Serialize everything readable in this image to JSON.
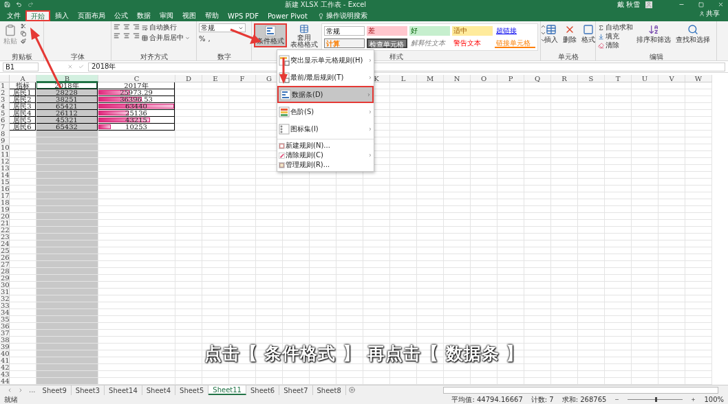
{
  "window": {
    "title": "新建 XLSX 工作表 - Excel",
    "user": "戴 秋雪",
    "share": "共享"
  },
  "ribbon_tabs": [
    {
      "label": "文件",
      "selected": false,
      "highlighted": false
    },
    {
      "label": "开始",
      "selected": true,
      "highlighted": true
    },
    {
      "label": "插入",
      "selected": false,
      "highlighted": false
    },
    {
      "label": "页面布局",
      "selected": false,
      "highlighted": false
    },
    {
      "label": "公式",
      "selected": false,
      "highlighted": false
    },
    {
      "label": "数据",
      "selected": false,
      "highlighted": false
    },
    {
      "label": "审阅",
      "selected": false,
      "highlighted": false
    },
    {
      "label": "视图",
      "selected": false,
      "highlighted": false
    },
    {
      "label": "帮助",
      "selected": false,
      "highlighted": false
    },
    {
      "label": "WPS PDF",
      "selected": false,
      "highlighted": false
    },
    {
      "label": "Power Pivot",
      "selected": false,
      "highlighted": false
    }
  ],
  "tell_me": "操作说明搜索",
  "clipboard": {
    "label": "剪贴板",
    "paste": "粘贴"
  },
  "font": {
    "label": "字体"
  },
  "alignment": {
    "label": "对齐方式",
    "wrap": "自动换行",
    "merge": "合并后居中"
  },
  "number": {
    "label": "数字",
    "format": "常规",
    "percent": "%",
    "comma": ","
  },
  "styles": {
    "label": "样式",
    "conditional": "条件格式",
    "conditional_highlighted": true,
    "table_format": [
      "套用",
      "表格格式"
    ],
    "gallery": [
      {
        "text": "常规",
        "kind": "normal"
      },
      {
        "text": "差",
        "kind": "bad"
      },
      {
        "text": "好",
        "kind": "good"
      },
      {
        "text": "适中",
        "kind": "neutral"
      },
      {
        "text": "超链接",
        "kind": "hyperlink"
      },
      {
        "text": "计算",
        "kind": "calc"
      },
      {
        "text": "检查单元格",
        "kind": "check"
      },
      {
        "text": "解释性文本",
        "kind": "explanatory"
      },
      {
        "text": "警告文本",
        "kind": "warning"
      },
      {
        "text": "链接单元格",
        "kind": "linked"
      }
    ]
  },
  "cells_group": {
    "label": "单元格",
    "buttons": [
      {
        "text": "插入",
        "kind": "insert"
      },
      {
        "text": "删除",
        "kind": "delete"
      },
      {
        "text": "格式",
        "kind": "format"
      }
    ]
  },
  "editing": {
    "label": "编辑",
    "items": [
      {
        "text": "自动求和",
        "kind": "sum"
      },
      {
        "text": "填充",
        "kind": "fill"
      },
      {
        "text": "清除",
        "kind": "clear"
      }
    ],
    "buttons": [
      {
        "text": "排序和筛选",
        "kind": "sort"
      },
      {
        "text": "查找和选择",
        "kind": "find"
      }
    ]
  },
  "formula_bar": {
    "name_box": "B1",
    "value": "2018年"
  },
  "sheet": {
    "columns": [
      {
        "label": "A",
        "selected": false
      },
      {
        "label": "B",
        "selected": true
      },
      {
        "label": "C",
        "selected": false
      },
      {
        "label": "D",
        "selected": false
      },
      {
        "label": "E",
        "selected": false
      },
      {
        "label": "F",
        "selected": false
      },
      {
        "label": "G",
        "selected": false
      },
      {
        "selected": false
      },
      {
        "selected": false
      },
      {
        "selected": false
      },
      {
        "label": "K",
        "selected": false
      },
      {
        "label": "L",
        "selected": false
      },
      {
        "label": "M",
        "selected": false
      },
      {
        "label": "N",
        "selected": false
      },
      {
        "label": "O",
        "selected": false
      },
      {
        "label": "P",
        "selected": false
      },
      {
        "label": "Q",
        "selected": false
      },
      {
        "label": "R",
        "selected": false
      },
      {
        "label": "S",
        "selected": false
      },
      {
        "label": "T",
        "selected": false
      },
      {
        "label": "U",
        "selected": false
      },
      {
        "label": "V",
        "selected": false
      },
      {
        "label": "W",
        "selected": false
      }
    ],
    "row_numbers": [
      "1",
      "2",
      "3",
      "4",
      "5",
      "6",
      "7",
      "8",
      "9",
      "10",
      "11",
      "12",
      "13",
      "14",
      "15",
      "16",
      "17",
      "18",
      "19",
      "20",
      "21",
      "22",
      "23",
      "24",
      "25",
      "26",
      "27",
      "28",
      "29",
      "30",
      "31",
      "32",
      "33",
      "34",
      "35",
      "36",
      "37",
      "38",
      "39",
      "40",
      "41",
      "42",
      "43",
      "44"
    ],
    "header": [
      "指标",
      "2018年",
      "2017年"
    ],
    "rows": [
      {
        "cells": [
          "居民1",
          "28228",
          "25973.29"
        ],
        "level": 0.41
      },
      {
        "cells": [
          "居民2",
          "38251",
          "36396.53"
        ],
        "level": 0.57
      },
      {
        "cells": [
          "居民3",
          "65421",
          "63440"
        ],
        "level": 1.0
      },
      {
        "cells": [
          "居民4",
          "26112",
          "25136"
        ],
        "level": 0.4
      },
      {
        "cells": [
          "居民5",
          "45321",
          "43215"
        ],
        "level": 0.68
      },
      {
        "cells": [
          "居民6",
          "65432",
          "10253"
        ],
        "level": 0.16
      }
    ]
  },
  "menu": [
    {
      "text": "突出显示单元格规则(H)",
      "kind": "large",
      "submenu": true,
      "selected": false
    },
    {
      "text": "最前/最后规则(T)",
      "kind": "large",
      "submenu": true,
      "selected": false
    },
    {
      "text": "数据条(D)",
      "kind": "large",
      "submenu": true,
      "selected": true
    },
    {
      "text": "色阶(S)",
      "kind": "large",
      "submenu": true,
      "selected": false
    },
    {
      "text": "图标集(I)",
      "kind": "large",
      "submenu": true,
      "selected": false
    },
    {
      "text": "新建规则(N)...",
      "kind": "small",
      "submenu": false,
      "selected": false
    },
    {
      "text": "清除规则(C)",
      "kind": "small",
      "submenu": true,
      "selected": false
    },
    {
      "text": "管理规则(R)...",
      "kind": "small",
      "submenu": false,
      "selected": false
    }
  ],
  "sheet_tabs": [
    {
      "label": "Sheet9",
      "selected": false
    },
    {
      "label": "Sheet3",
      "selected": false
    },
    {
      "label": "Sheet14",
      "selected": false
    },
    {
      "label": "Sheet4",
      "selected": false
    },
    {
      "label": "Sheet5",
      "selected": false
    },
    {
      "label": "Sheet11",
      "selected": true
    },
    {
      "label": "Sheet6",
      "selected": false
    },
    {
      "label": "Sheet7",
      "selected": false
    },
    {
      "label": "Sheet8",
      "selected": false
    }
  ],
  "tab_overflow": "...",
  "status_bar": {
    "ready": "就绪",
    "average": "平均值: 44794.16667",
    "count": "计数: 7",
    "sum": "求和: 268765",
    "zoom": {
      "level": 0.5,
      "reading": "100%"
    }
  },
  "caption": "点击【 条件格式 】 再点击【 数据条 】"
}
